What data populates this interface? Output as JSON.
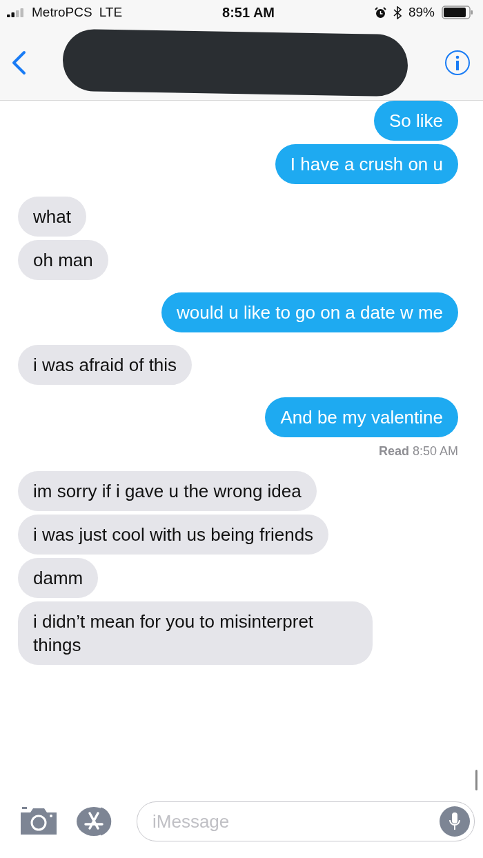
{
  "status_bar": {
    "carrier": "MetroPCS",
    "network": "LTE",
    "time": "8:51 AM",
    "battery": "89%"
  },
  "messages": [
    {
      "kind": "sent",
      "text": "So like"
    },
    {
      "kind": "sent",
      "text": "I have a crush on u"
    },
    {
      "kind": "received",
      "text": "what"
    },
    {
      "kind": "received",
      "text": "oh man"
    },
    {
      "kind": "sent",
      "text": "would u like to go on a date w me"
    },
    {
      "kind": "received",
      "text": "i was afraid of this"
    },
    {
      "kind": "sent",
      "text": "And be my valentine"
    },
    {
      "kind": "receipt",
      "text": "**Read** 8:50 AM"
    },
    {
      "kind": "received",
      "text": "im sorry if i gave u the wrong idea"
    },
    {
      "kind": "received",
      "text": "i was just cool with us being friends"
    },
    {
      "kind": "received",
      "text": "damm"
    },
    {
      "kind": "received",
      "text": "i didn’t mean for you to misinterpret things"
    }
  ],
  "composer": {
    "placeholder": "iMessage"
  }
}
